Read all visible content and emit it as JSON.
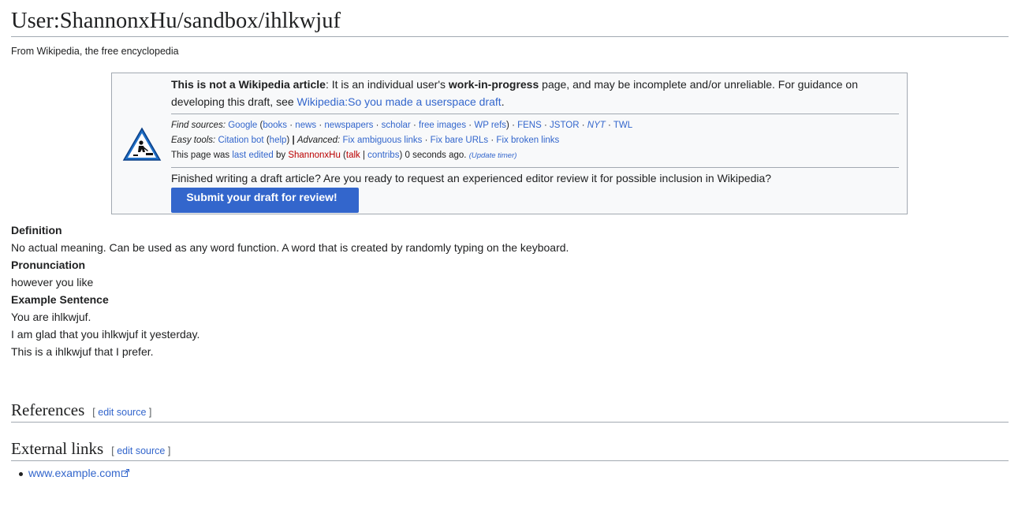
{
  "page": {
    "title": "User:ShannonxHu/sandbox/ihlkwjuf",
    "tagline": "From Wikipedia, the free encyclopedia"
  },
  "draft_box": {
    "icon": "construction-worker-warning-icon",
    "intro": {
      "bold_lead": "This is not a Wikipedia article",
      "text1": ": It is an individual user's ",
      "bold_wip": "work-in-progress",
      "text2": " page, and may be incomplete and/or unreliable. For guidance on developing this draft, see ",
      "guidance_link": "Wikipedia:So you made a userspace draft",
      "end": "."
    },
    "find_sources": {
      "label": "Find sources:",
      "google": "Google",
      "links": [
        "books",
        "news",
        "newspapers",
        "scholar",
        "free images",
        "WP refs"
      ],
      "extra": [
        "FENS",
        "JSTOR",
        "NYT",
        "TWL"
      ]
    },
    "easy_tools": {
      "label": "Easy tools:",
      "citation_bot": "Citation bot",
      "help": "help",
      "advanced_label": "Advanced:",
      "fix_ambiguous": "Fix ambiguous links",
      "fix_bare": "Fix bare URLs",
      "fix_broken": "Fix broken links"
    },
    "last_edited": {
      "text1": "This page was ",
      "last_edited_link": "last edited",
      "by": " by ",
      "user": "ShannonxHu",
      "talk": "talk",
      "contribs": "contribs",
      "time": " 0 seconds ago.",
      "update_timer": "(Update timer)"
    },
    "review_question": "Finished writing a draft article? Are you ready to request an experienced editor review it for possible inclusion in Wikipedia?",
    "submit_label": "Submit your draft for review!"
  },
  "content": {
    "definition_heading": "Definition",
    "definition_text": "No actual meaning. Can be used as any word function. A word that is created by randomly typing on the keyboard.",
    "pronunciation_heading": "Pronunciation",
    "pronunciation_text": "however you like",
    "example_heading": "Example Sentence",
    "examples": [
      "You are ihlkwjuf.",
      "I am glad that you ihlkwjuf it yesterday.",
      "This is a ihlkwjuf that I prefer."
    ]
  },
  "sections": {
    "references": "References",
    "external_links": "External links",
    "edit_source": "edit source",
    "bracket_open": "[",
    "bracket_close": "]"
  },
  "external_links": [
    "www.example.com"
  ]
}
